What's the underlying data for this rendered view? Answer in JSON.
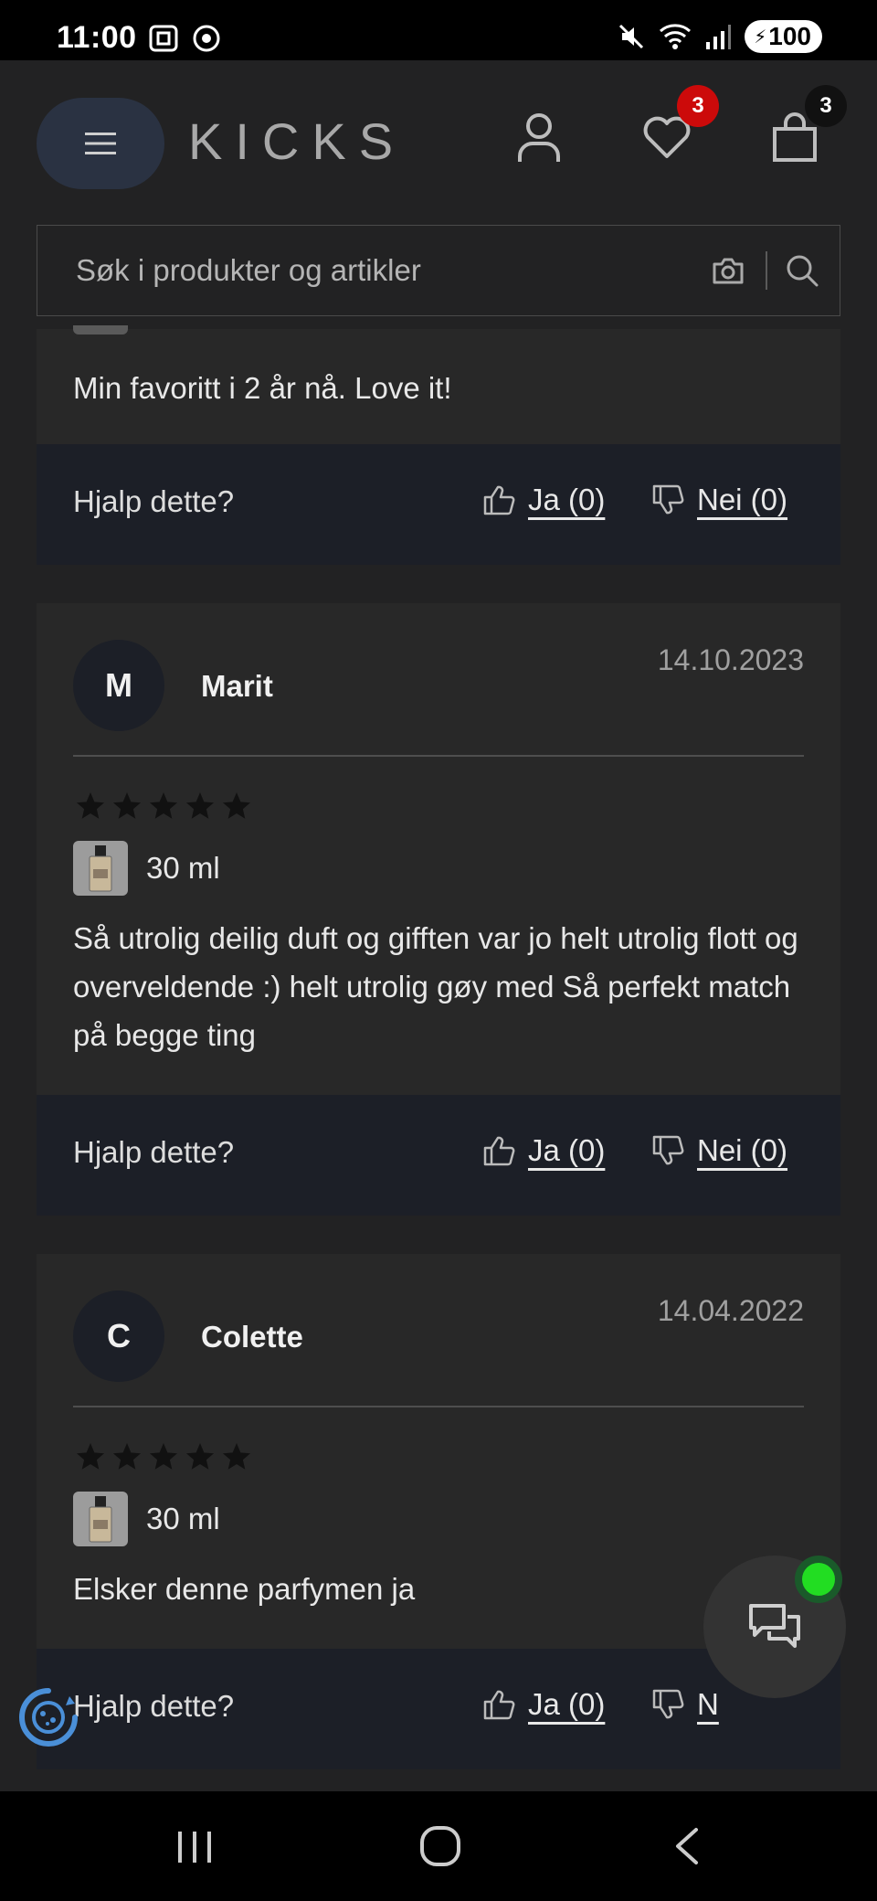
{
  "status_bar": {
    "time": "11:00",
    "battery": "100"
  },
  "header": {
    "logo": "KICKS",
    "wishlist_count": "3",
    "cart_count": "3",
    "colors": {
      "wishlist_badge": "#cc0a0a",
      "cart_badge": "#111111"
    }
  },
  "search": {
    "placeholder": "Søk i produkter og artikler"
  },
  "reviews": {
    "helpful_label": "Hjalp dette?",
    "partial_review": {
      "text": "Min favoritt i 2 år nå. Love it!",
      "yes": "Ja (0)",
      "no": "Nei (0)"
    },
    "items": [
      {
        "initial": "M",
        "name": "Marit",
        "date": "14.10.2023",
        "rating": 5,
        "variant": "30 ml",
        "text": "Så utrolig deilig duft og gifften var jo helt utrolig flott og overveldende :) helt utrolig gøy med Så perfekt match på begge ting",
        "yes": "Ja (0)",
        "no": "Nei (0)"
      },
      {
        "initial": "C",
        "name": "Colette",
        "date": "14.04.2022",
        "rating": 5,
        "variant": "30 ml",
        "text": "Elsker denne parfymen ja",
        "yes": "Ja (0)",
        "no": "N"
      }
    ]
  },
  "icons": {
    "menu": "hamburger-icon",
    "account": "user-icon",
    "wishlist": "heart-icon",
    "cart": "shopping-bag-icon",
    "camera": "camera-icon",
    "search": "search-icon",
    "chat": "chat-icon",
    "cookie": "cookie-settings-icon"
  }
}
